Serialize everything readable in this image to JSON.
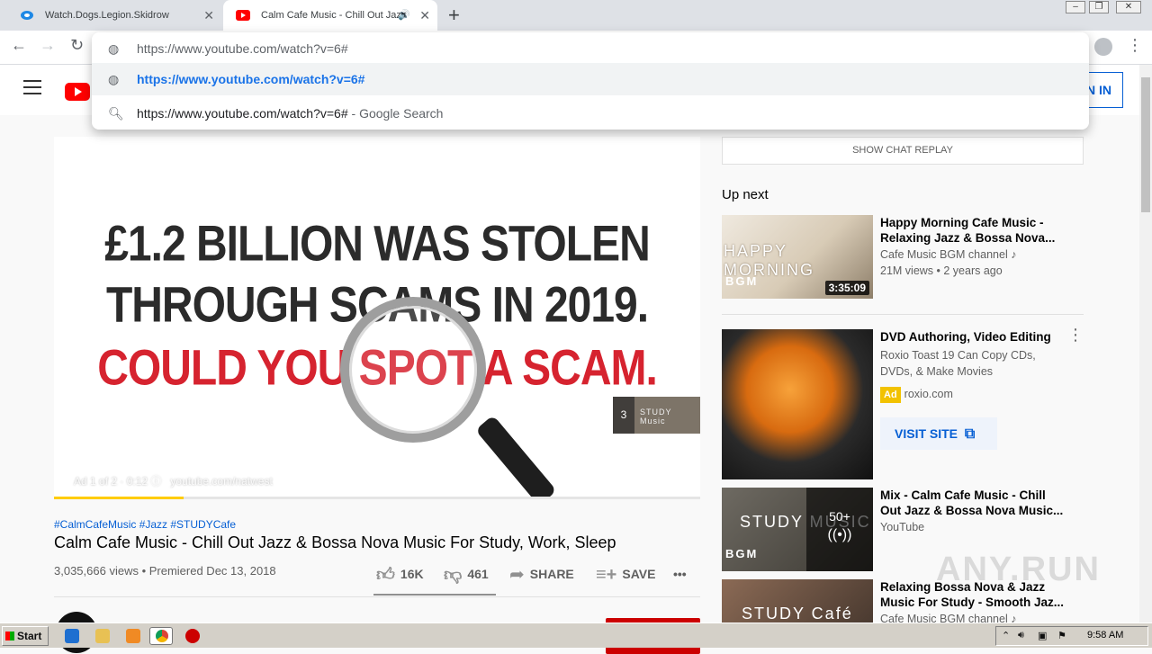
{
  "browser": {
    "tabs": [
      {
        "title": "Watch.Dogs.Legion.Skidrow",
        "active": false
      },
      {
        "title": "Calm Cafe Music - Chill Out Jazz",
        "active": true
      }
    ],
    "new_tab": "+",
    "omnibox": {
      "input_value": "https://www.youtube.com/watch?v=6#",
      "suggestion_url": "https://www.youtube.com/watch?v=6#",
      "search_query": "https://www.youtube.com/watch?v=6#",
      "search_suffix": " - Google Search"
    }
  },
  "youtube": {
    "sign_in": "IN IN",
    "player": {
      "headline_1": "£1.2 BILLION WAS STOLEN",
      "headline_2": "THROUGH SCAMS IN 2019.",
      "headline_3": "COULD YOU SPOT A SCAM.",
      "ad_info": "Ad 1 of 2 · 0:12 ⓘ",
      "ad_url": "youtube.com/natwest",
      "next_count": "3",
      "next_label": "STUDY Music",
      "progress": 0.2,
      "progress_color": "#ffcc00"
    },
    "video": {
      "hashtags": "#CalmCafeMusic #Jazz #STUDYCafe",
      "title": "Calm Cafe Music - Chill Out Jazz & Bossa Nova Music For Study, Work, Sleep",
      "views": "3,035,666 views • Premiered Dec 13, 2018",
      "likes": "16K",
      "dislikes": "461",
      "share": "SHARE",
      "save": "SAVE",
      "more": "•••"
    },
    "sidebar": {
      "chat_replay": "SHOW CHAT REPLAY",
      "up_next": "Up next",
      "items": [
        {
          "title": "Happy Morning Cafe Music - Relaxing Jazz & Bossa Nova...",
          "channel": "Cafe Music BGM channel ♪",
          "meta": "21M views • 2 years ago",
          "duration": "3:35:09",
          "thumb_text": "HAPPY MORNING",
          "thumb_sub": "BGM"
        },
        {
          "title": "DVD Authoring, Video Editing",
          "description": "Roxio Toast 19 Can Copy CDs, DVDs, & Make Movies",
          "ad_badge": "Ad",
          "advertiser": "roxio.com",
          "visit_site": "VISIT SITE"
        },
        {
          "title": "Mix - Calm Cafe Music - Chill Out Jazz & Bossa Nova Music...",
          "channel": "YouTube",
          "playlist_count": "50+",
          "thumb_text": "STUDY MUSIC",
          "thumb_sub": "BGM"
        },
        {
          "title": "Relaxing Bossa Nova & Jazz Music For Study - Smooth Jaz...",
          "channel": "Cafe Music BGM channel ♪",
          "thumb_text": "STUDY Café"
        }
      ]
    }
  },
  "watermark": "ANY.RUN",
  "taskbar": {
    "start": "Start",
    "clock": "9:58 AM"
  }
}
